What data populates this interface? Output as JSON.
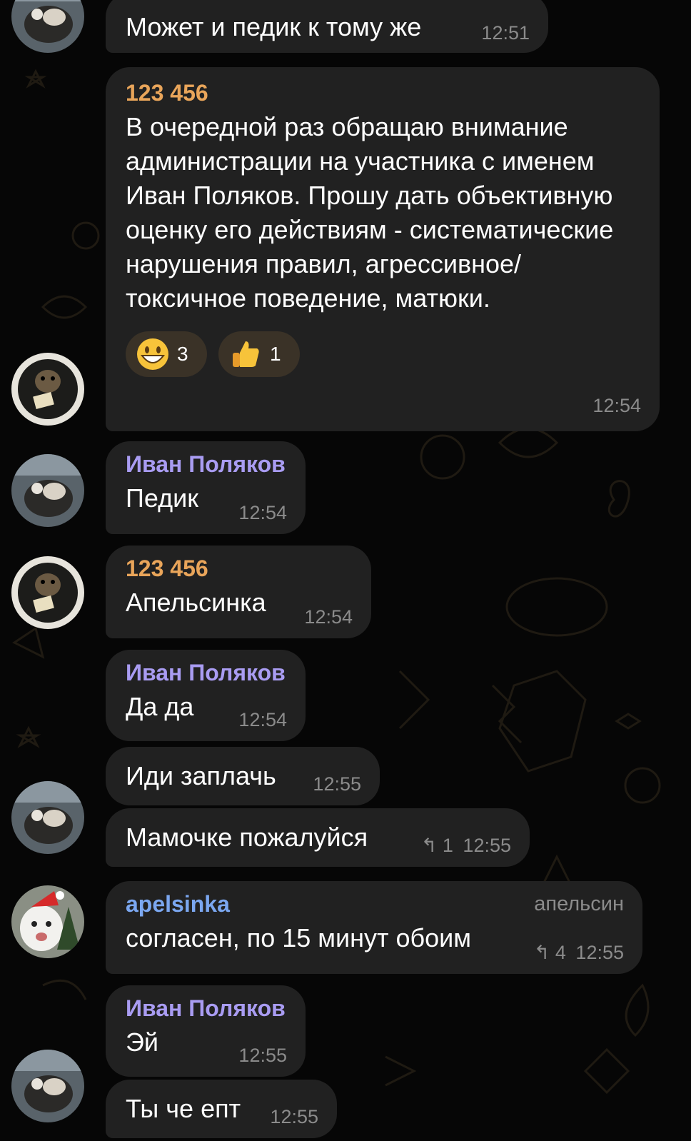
{
  "messages": [
    {
      "sender": "",
      "text": "Может и педик к тому же",
      "time": "12:51"
    },
    {
      "sender": "123 456",
      "text": "В очередной раз обращаю внимание администрации на участника с именем Иван Поляков. Прошу дать объективную оценку его действиям - систематические нарушения правил, агрессивное/токсичное поведение, матюки.",
      "time": "12:54",
      "reactions": [
        {
          "icon": "grinning-face-emoji",
          "count": "3"
        },
        {
          "icon": "thumbs-up-emoji",
          "count": "1"
        }
      ]
    },
    {
      "sender": "Иван Поляков",
      "text": "Педик",
      "time": "12:54"
    },
    {
      "sender": "123 456",
      "text": "Апельсинка",
      "time": "12:54"
    },
    {
      "sender": "Иван Поляков",
      "text": "Да да",
      "time": "12:54"
    },
    {
      "sender": "",
      "text": "Иди заплачь",
      "time": "12:55"
    },
    {
      "sender": "",
      "text": "Мамочке пожалуйся",
      "time": "12:55",
      "replies": "1"
    },
    {
      "sender": "apelsinka",
      "role": "апельсин",
      "text": "согласен, по 15 минут обоим",
      "time": "12:55",
      "replies": "4"
    },
    {
      "sender": "Иван Поляков",
      "text": "Эй",
      "time": "12:55"
    },
    {
      "sender": "",
      "text": "Ты че епт",
      "time": "12:55"
    }
  ],
  "colors": {
    "background": "#060606",
    "bubble": "#212121",
    "sender_123456": "#e9a55a",
    "sender_ivan": "#a99cf2",
    "sender_apelsinka": "#7ba7f0",
    "time": "#8b8b8b"
  }
}
